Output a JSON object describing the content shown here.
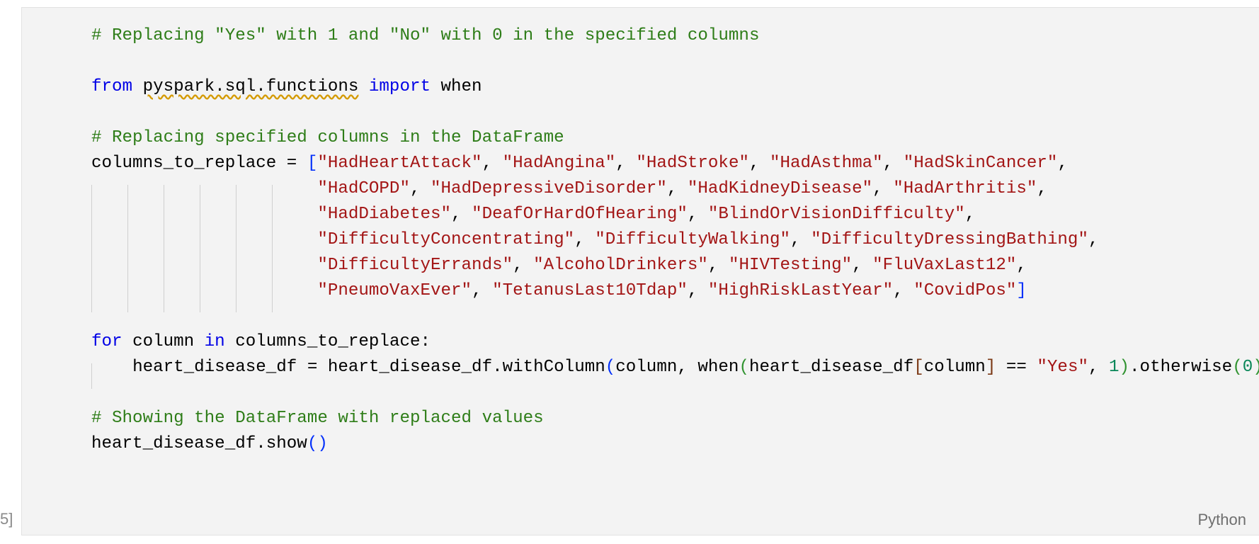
{
  "cell": {
    "execution_count": "5]",
    "language_label": "Python"
  },
  "code": {
    "comment_header": "# Replacing \"Yes\" with 1 and \"No\" with 0 in the specified columns",
    "import_from": "from",
    "import_module": "pyspark.sql.functions",
    "import_kw": "import",
    "import_name": "when",
    "comment_replace": "# Replacing specified columns in the DataFrame",
    "assign_prefix": "columns_to_replace = ",
    "columns": [
      "\"HadHeartAttack\"",
      "\"HadAngina\"",
      "\"HadStroke\"",
      "\"HadAsthma\"",
      "\"HadSkinCancer\"",
      "\"HadCOPD\"",
      "\"HadDepressiveDisorder\"",
      "\"HadKidneyDisease\"",
      "\"HadArthritis\"",
      "\"HadDiabetes\"",
      "\"DeafOrHardOfHearing\"",
      "\"BlindOrVisionDifficulty\"",
      "\"DifficultyConcentrating\"",
      "\"DifficultyWalking\"",
      "\"DifficultyDressingBathing\"",
      "\"DifficultyErrands\"",
      "\"AlcoholDrinkers\"",
      "\"HIVTesting\"",
      "\"FluVaxLast12\"",
      "\"PneumoVaxEver\"",
      "\"TetanusLast10Tdap\"",
      "\"HighRiskLastYear\"",
      "\"CovidPos\""
    ],
    "for_kw": "for",
    "for_var": "column",
    "in_kw": "in",
    "for_iter": "columns_to_replace:",
    "body_prefix": "heart_disease_df = heart_disease_df.withColumn",
    "body_arg1": "column, when",
    "body_inner": "heart_disease_df",
    "body_idx": "column",
    "body_eq": " == ",
    "yes_str": "\"Yes\"",
    "one": "1",
    "otherwise": ".otherwise",
    "zero": "0",
    "comment_show": "# Showing the DataFrame with replaced values",
    "show_obj": "heart_disease_df.show"
  }
}
